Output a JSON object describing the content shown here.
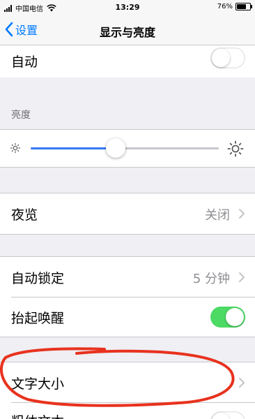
{
  "status_bar": {
    "carrier": "中国电信",
    "time": "13:29",
    "battery_pct": "76%",
    "battery_level": 0.76
  },
  "nav": {
    "back_label": "设置",
    "title": "显示与亮度"
  },
  "rows": {
    "auto": {
      "label": "自动",
      "toggle": "off"
    },
    "brightness_header": "亮度",
    "brightness_level": 0.45,
    "night_shift": {
      "label": "夜览",
      "value": "关闭"
    },
    "auto_lock": {
      "label": "自动锁定",
      "value": "5 分钟"
    },
    "raise_to_wake": {
      "label": "抬起唤醒",
      "toggle": "on"
    },
    "text_size": {
      "label": "文字大小"
    },
    "bold_text": {
      "label": "粗体文本",
      "toggle": "off"
    }
  },
  "colors": {
    "accent": "#007aff",
    "slider_fill": "#3478f6",
    "toggle_on": "#4cd964",
    "annotation": "#e8321e",
    "background": "#efeff4"
  }
}
